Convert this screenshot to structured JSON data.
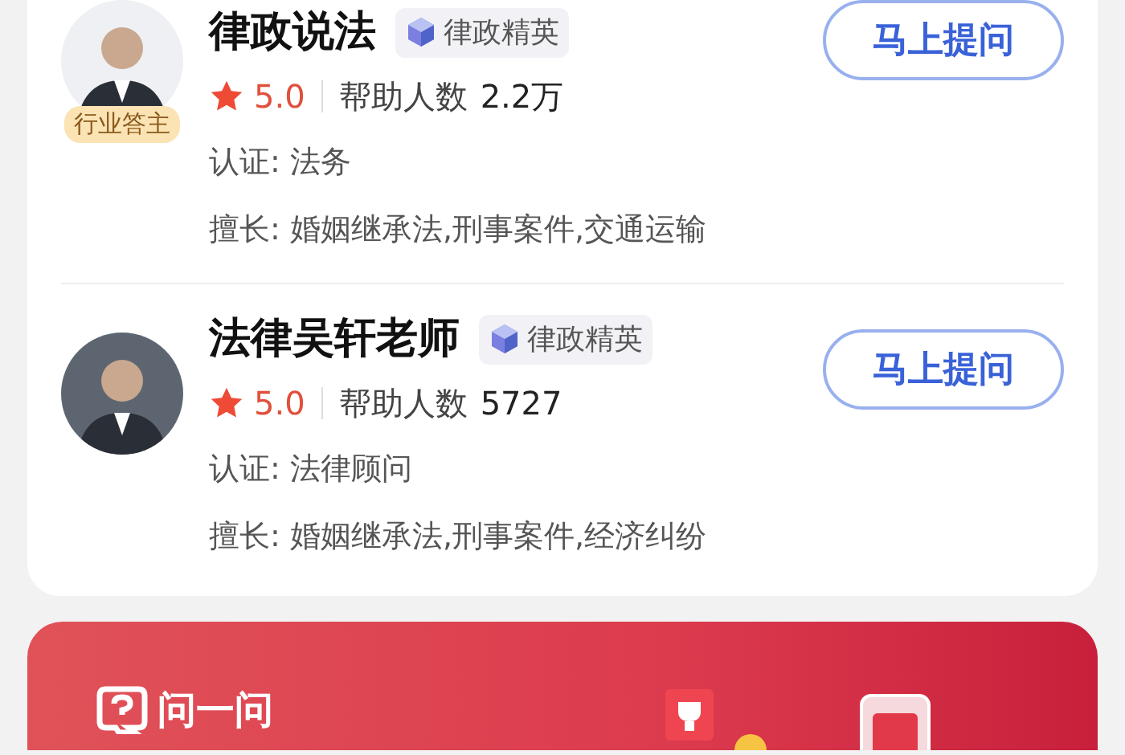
{
  "experts": [
    {
      "name": "律政说法",
      "tag": "律政精英",
      "badge": "行业答主",
      "rating": "5.0",
      "helped_label": "帮助人数",
      "helped": "2.2万",
      "cert": "认证: 法务",
      "specialty": "擅长: 婚姻继承法,刑事案件,交通运输",
      "button": "马上提问"
    },
    {
      "name": "法律吴轩老师",
      "tag": "律政精英",
      "rating": "5.0",
      "helped_label": "帮助人数",
      "helped": "5727",
      "cert": "认证: 法律顾问",
      "specialty": "擅长: 婚姻继承法,刑事案件,经济纠纷",
      "button": "马上提问"
    }
  ],
  "banner": {
    "title": "问一问"
  }
}
